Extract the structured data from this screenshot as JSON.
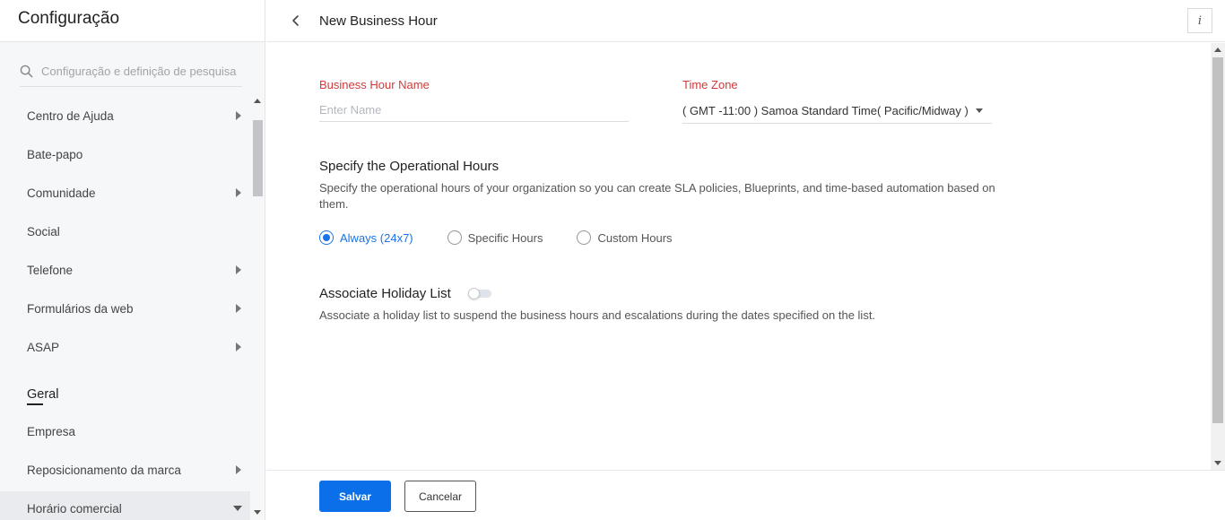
{
  "sidebar": {
    "title": "Configuração",
    "search_placeholder": "Configuração e definição de pesquisa",
    "items": [
      {
        "label": "Centro de Ajuda",
        "has_children": true
      },
      {
        "label": "Bate-papo",
        "has_children": false
      },
      {
        "label": "Comunidade",
        "has_children": true
      },
      {
        "label": "Social",
        "has_children": false
      },
      {
        "label": "Telefone",
        "has_children": true
      },
      {
        "label": "Formulários da web",
        "has_children": true
      },
      {
        "label": "ASAP",
        "has_children": true
      }
    ],
    "section_general": "Geral",
    "general_items": [
      {
        "label": "Empresa",
        "has_children": false
      },
      {
        "label": "Reposicionamento da marca",
        "has_children": true
      },
      {
        "label": "Horário comercial",
        "has_children": true,
        "expanded": true
      }
    ]
  },
  "header": {
    "back_icon": "chevron-left-icon",
    "title": "New Business Hour",
    "info_icon": "info-icon",
    "info_glyph": "i"
  },
  "form": {
    "name_label": "Business Hour Name",
    "name_placeholder": "Enter Name",
    "name_value": "",
    "timezone_label": "Time Zone",
    "timezone_value": "( GMT -11:00 ) Samoa Standard Time( Pacific/Midway )",
    "operational": {
      "title": "Specify the Operational Hours",
      "description": "Specify the operational hours of your organization so you can create SLA policies, Blueprints, and time-based automation based on them.",
      "options": [
        {
          "label": "Always (24x7)",
          "checked": true
        },
        {
          "label": "Specific Hours",
          "checked": false
        },
        {
          "label": "Custom Hours",
          "checked": false
        }
      ]
    },
    "holiday": {
      "title": "Associate Holiday List",
      "enabled": false,
      "description": "Associate a holiday list to suspend the business hours and escalations during the dates specified on the list."
    }
  },
  "footer": {
    "save_label": "Salvar",
    "cancel_label": "Cancelar"
  },
  "colors": {
    "primary": "#0a6fe8",
    "required_label": "#d13a3a",
    "radio_checked": "#1a73e8"
  }
}
